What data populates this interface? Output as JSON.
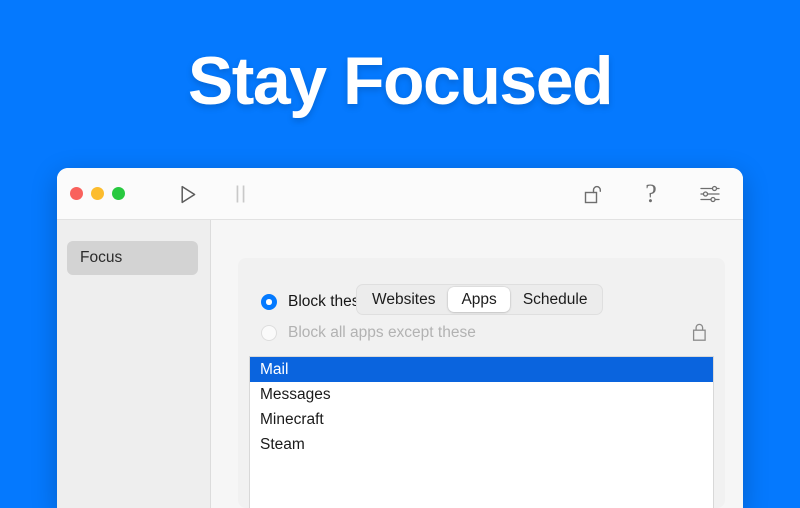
{
  "promo": {
    "headline": "Stay Focused",
    "background_color": "#0579FE"
  },
  "window": {
    "titlebar": {
      "traffic_lights": [
        {
          "name": "close",
          "color": "#F9615C"
        },
        {
          "name": "minimize",
          "color": "#FCBC2D"
        },
        {
          "name": "zoom",
          "color": "#28C93F"
        }
      ],
      "buttons": [
        {
          "icon": "play-icon",
          "state": "enabled"
        },
        {
          "icon": "pause-icon",
          "state": "disabled"
        },
        {
          "icon": "unlock-icon",
          "state": "enabled"
        },
        {
          "icon": "help-icon",
          "label": "?",
          "state": "enabled"
        },
        {
          "icon": "preferences-sliders-icon",
          "state": "enabled"
        }
      ]
    },
    "sidebar": {
      "items": [
        {
          "label": "Focus",
          "selected": true
        }
      ]
    },
    "main": {
      "tabs": [
        {
          "label": "Websites",
          "selected": false
        },
        {
          "label": "Apps",
          "selected": true
        },
        {
          "label": "Schedule",
          "selected": false
        }
      ],
      "radio_options": [
        {
          "label": "Block these apps",
          "selected": true,
          "disabled": false
        },
        {
          "label": "Block all apps except these",
          "selected": false,
          "disabled": true,
          "lock_icon": "lock-closed-icon"
        }
      ],
      "app_list": [
        {
          "label": "Mail",
          "selected": true
        },
        {
          "label": "Messages",
          "selected": false
        },
        {
          "label": "Minecraft",
          "selected": false
        },
        {
          "label": "Steam",
          "selected": false
        }
      ]
    }
  },
  "colors": {
    "brand_blue": "#0579FE",
    "accent_blue": "#047AFF",
    "selection_blue": "#0A64DE"
  }
}
